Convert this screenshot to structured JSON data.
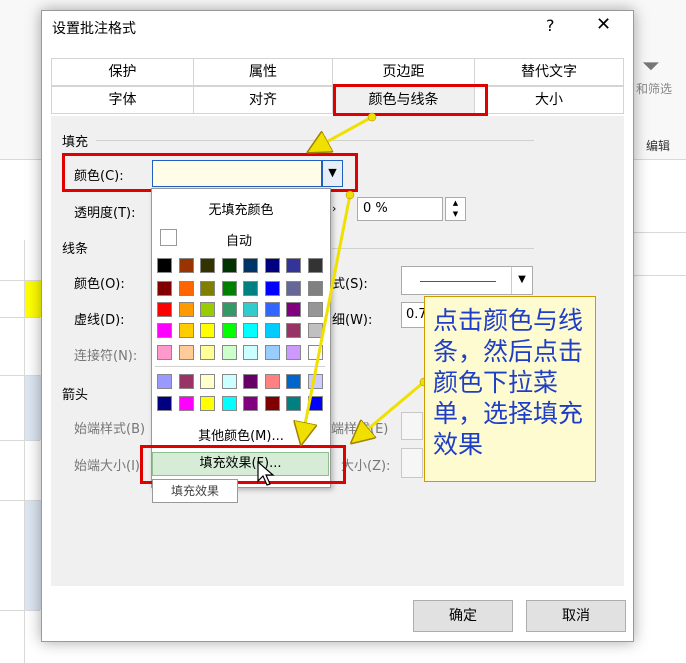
{
  "dialog": {
    "title": "设置批注格式",
    "help_glyph": "?",
    "close_glyph": "✕",
    "tabs_row1": [
      "保护",
      "属性",
      "页边距",
      "替代文字"
    ],
    "tabs_row2": [
      "字体",
      "对齐",
      "颜色与线条",
      "大小"
    ],
    "active_tab": "颜色与线条"
  },
  "fill": {
    "section": "填充",
    "color_label": "颜色(C):",
    "transparency_label": "透明度(T):",
    "transparency_value": "0 %"
  },
  "line": {
    "section": "线条",
    "color_label": "颜色(O):",
    "dash_label": "虚线(D):",
    "connector_label": "连接符(N):",
    "style_label": "式(S):",
    "weight_label": "细(W):",
    "weight_value": "0.7"
  },
  "arrows": {
    "section": "箭头",
    "begin_style_label": "始端样式(B)",
    "begin_size_label": "始端大小(I):",
    "end_style_label": "端样式(E)",
    "end_size_label": "大小(Z):"
  },
  "palette": {
    "no_fill": "无填充颜色",
    "automatic": "自动",
    "more_colors": "其他颜色(M)...",
    "fill_effects": "填充效果(F)...",
    "tooltip": "填充效果",
    "rows": [
      [
        "#000000",
        "#993300",
        "#333300",
        "#003300",
        "#003366",
        "#000080",
        "#333399",
        "#333333"
      ],
      [
        "#800000",
        "#ff6600",
        "#808000",
        "#008000",
        "#008080",
        "#0000ff",
        "#666699",
        "#808080"
      ],
      [
        "#ff0000",
        "#ff9900",
        "#99cc00",
        "#339966",
        "#33cccc",
        "#3366ff",
        "#800080",
        "#969696"
      ],
      [
        "#ff00ff",
        "#ffcc00",
        "#ffff00",
        "#00ff00",
        "#00ffff",
        "#00ccff",
        "#993366",
        "#c0c0c0"
      ],
      [
        "#ff99cc",
        "#ffcc99",
        "#ffff99",
        "#ccffcc",
        "#ccffff",
        "#99ccff",
        "#cc99ff",
        "#ffffff"
      ],
      [
        "#9999ff",
        "#993366",
        "#ffffcc",
        "#ccffff",
        "#660066",
        "#ff8080",
        "#0066cc",
        "#ccccff"
      ],
      [
        "#000080",
        "#ff00ff",
        "#ffff00",
        "#00ffff",
        "#800080",
        "#800000",
        "#008080",
        "#0000ff"
      ]
    ]
  },
  "buttons": {
    "ok": "确定",
    "cancel": "取消"
  },
  "callout": {
    "text": "点击颜色与线条，然后点击颜色下拉菜单，选择填充效果"
  },
  "ribbon": {
    "sort_filter": "和筛选",
    "edit": "编辑"
  },
  "colors": {
    "annotation_red": "#e00000",
    "arrow_yellow": "#f0e000",
    "callout_text": "#1e3ec8",
    "callout_bg": "#fffbd0"
  }
}
